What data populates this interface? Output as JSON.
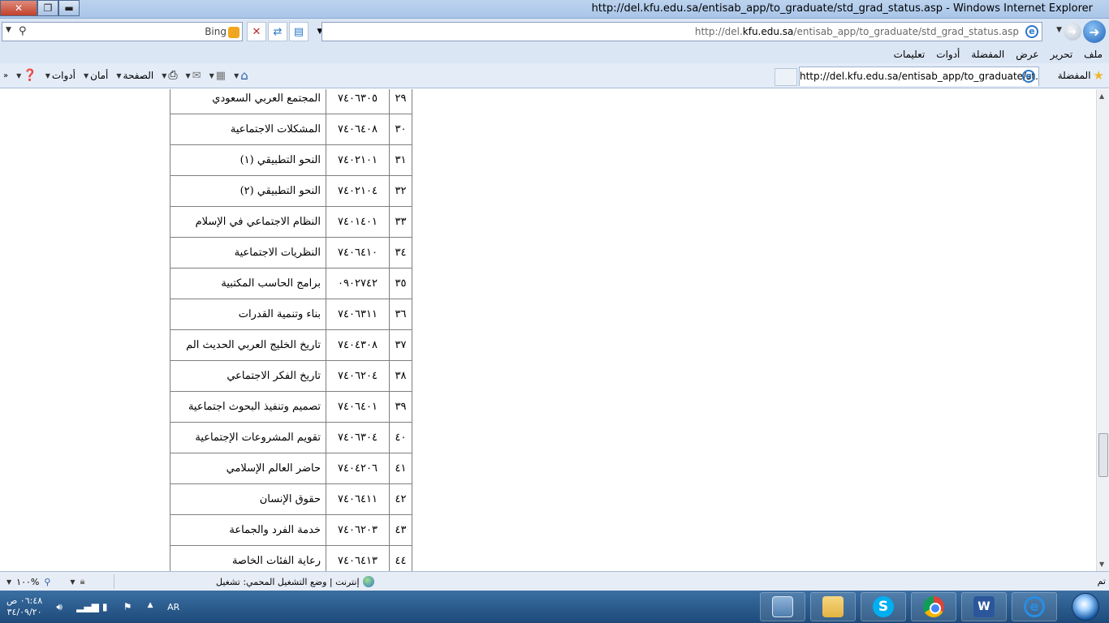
{
  "window": {
    "title": "http://del.kfu.edu.sa/entisab_app/to_graduate/std_grad_status.asp - Windows Internet Explorer"
  },
  "address_bar": {
    "url_prefix": "http://del.",
    "url_domain": "kfu.edu.sa",
    "url_path": "/entisab_app/to_graduate/std_grad_status.asp"
  },
  "search": {
    "provider": "Bing",
    "value": ""
  },
  "menu": [
    "ملف",
    "تحرير",
    "عرض",
    "المفضلة",
    "أدوات",
    "تعليمات"
  ],
  "favorites": {
    "label": "المفضلة"
  },
  "tab": {
    "title": "http://del.kfu.edu.sa/entisab_app/to_graduate/st..."
  },
  "command_bar": {
    "page": "الصفحة",
    "safety": "أمان",
    "tools": "أدوات"
  },
  "courses": [
    {
      "n": "٢٩",
      "code": "٧٤٠٦٣٠٥",
      "name": "المجتمع العربي السعودي"
    },
    {
      "n": "٣٠",
      "code": "٧٤٠٦٤٠٨",
      "name": "المشكلات الاجتماعية"
    },
    {
      "n": "٣١",
      "code": "٧٤٠٢١٠١",
      "name": "النحو التطبيقي (١)"
    },
    {
      "n": "٣٢",
      "code": "٧٤٠٢١٠٤",
      "name": "النحو التطبيقي (٢)"
    },
    {
      "n": "٣٣",
      "code": "٧٤٠١٤٠١",
      "name": "النظام الاجتماعي في الإسلام"
    },
    {
      "n": "٣٤",
      "code": "٧٤٠٦٤١٠",
      "name": "النظريات الاجتماعية"
    },
    {
      "n": "٣٥",
      "code": "٠٩٠٢٧٤٢",
      "name": "برامج الحاسب المكتبية"
    },
    {
      "n": "٣٦",
      "code": "٧٤٠٦٣١١",
      "name": "بناء وتنمية القدرات"
    },
    {
      "n": "٣٧",
      "code": "٧٤٠٤٣٠٨",
      "name": "تاريخ الخليج العربي الحديث الم"
    },
    {
      "n": "٣٨",
      "code": "٧٤٠٦٢٠٤",
      "name": "تاريخ الفكر الاجتماعي"
    },
    {
      "n": "٣٩",
      "code": "٧٤٠٦٤٠١",
      "name": "تصميم وتنفيذ البحوث اجتماعية"
    },
    {
      "n": "٤٠",
      "code": "٧٤٠٦٣٠٤",
      "name": "تقويم المشروعات الإجتماعية"
    },
    {
      "n": "٤١",
      "code": "٧٤٠٤٢٠٦",
      "name": "حاضر العالم الإسلامي"
    },
    {
      "n": "٤٢",
      "code": "٧٤٠٦٤١١",
      "name": "حقوق الإنسان"
    },
    {
      "n": "٤٣",
      "code": "٧٤٠٦٢٠٣",
      "name": "خدمة الفرد والجماعة"
    },
    {
      "n": "٤٤",
      "code": "٧٤٠٦٤١٣",
      "name": "رعاية الفئات الخاصة"
    }
  ],
  "status_bar": {
    "done": "تم",
    "zone": "إنترنت | وضع التشغيل المحمي: تشغيل",
    "zoom": "١٠٠%"
  },
  "taskbar": {
    "language": "AR",
    "time": "٠٦:٤٨ ص",
    "date": "٣٤/٠٩/٢٠"
  }
}
